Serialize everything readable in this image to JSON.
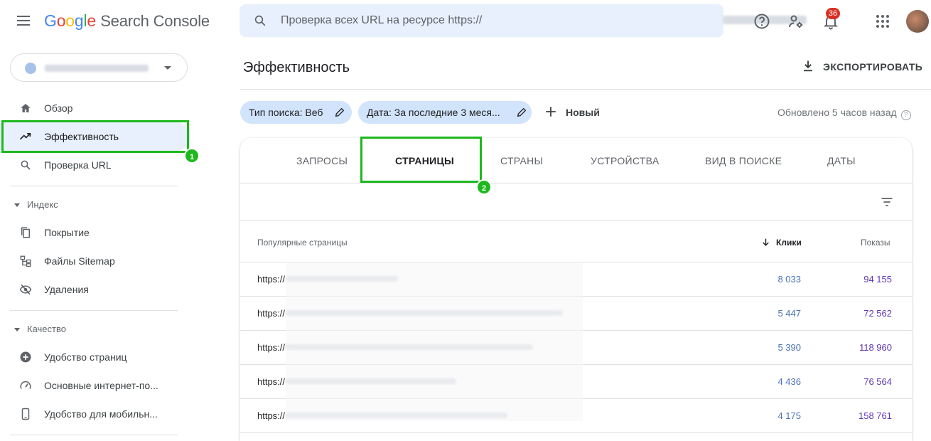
{
  "app": {
    "logo_letters": [
      "G",
      "o",
      "o",
      "g",
      "l",
      "e"
    ],
    "logo_product": "Search Console"
  },
  "search": {
    "placeholder": "Проверка всех URL на ресурсе https://"
  },
  "topbar": {
    "notifications_count": "36"
  },
  "sidebar": {
    "items_top": [
      {
        "label": "Обзор",
        "icon": "home-icon"
      },
      {
        "label": "Эффективность",
        "icon": "trending-up-icon"
      },
      {
        "label": "Проверка URL",
        "icon": "search-icon"
      }
    ],
    "section_index": "Индекс",
    "items_index": [
      {
        "label": "Покрытие",
        "icon": "file-copy-icon"
      },
      {
        "label": "Файлы Sitemap",
        "icon": "sitemap-icon"
      },
      {
        "label": "Удаления",
        "icon": "visibility-off-icon"
      }
    ],
    "section_quality": "Качество",
    "items_quality": [
      {
        "label": "Удобство страниц",
        "icon": "plus-circle-icon"
      },
      {
        "label": "Основные интернет-по...",
        "icon": "speed-icon"
      },
      {
        "label": "Удобство для мобильн...",
        "icon": "phone-icon"
      }
    ]
  },
  "annotations": {
    "badge1": "1",
    "badge2": "2"
  },
  "main": {
    "title": "Эффективность",
    "export_label": "ЭКСПОРТИРОВАТЬ",
    "chips": [
      {
        "label": "Тип поиска: Веб"
      },
      {
        "label": "Дата: За последние 3 меся..."
      }
    ],
    "new_label": "Новый",
    "updated": "Обновлено 5 часов назад"
  },
  "tabs": [
    "ЗАПРОСЫ",
    "СТРАНИЦЫ",
    "СТРАНЫ",
    "УСТРОЙСТВА",
    "ВИД В ПОИСКЕ",
    "ДАТЫ"
  ],
  "table": {
    "col_pages": "Популярные страницы",
    "col_clicks": "Клики",
    "col_impressions": "Показы",
    "rows": [
      {
        "url": "https://",
        "clicks": "8 033",
        "impressions": "94 155"
      },
      {
        "url": "https://",
        "clicks": "5 447",
        "impressions": "72 562"
      },
      {
        "url": "https://",
        "clicks": "5 390",
        "impressions": "118 960"
      },
      {
        "url": "https://",
        "clicks": "4 436",
        "impressions": "76 564"
      },
      {
        "url": "https://",
        "clicks": "4 175",
        "impressions": "158 761"
      }
    ]
  }
}
